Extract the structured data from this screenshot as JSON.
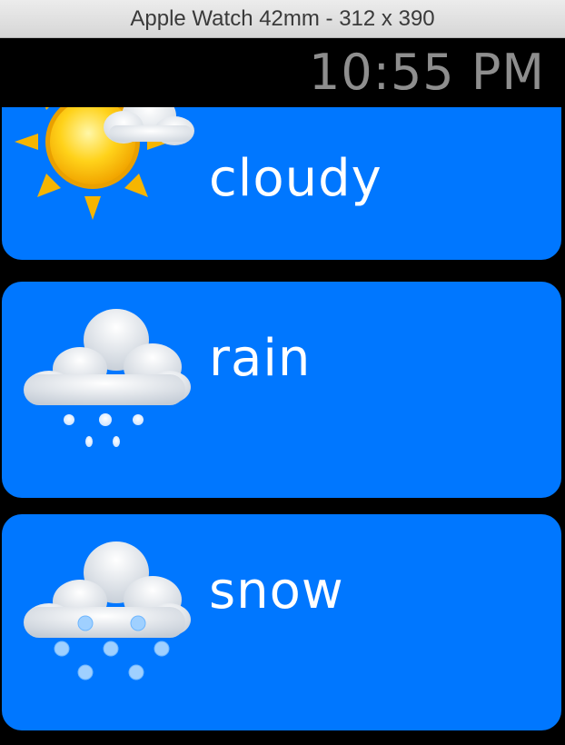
{
  "window": {
    "title": "Apple Watch 42mm - 312 x 390"
  },
  "status": {
    "time": "10:55 PM"
  },
  "rows": [
    {
      "label": "cloudy",
      "icon": "partly-cloudy-sun-icon"
    },
    {
      "label": "rain",
      "icon": "rain-cloud-icon"
    },
    {
      "label": "snow",
      "icon": "snow-cloud-icon"
    }
  ],
  "colors": {
    "card": "#0077ff",
    "time": "#8e8e8e",
    "background": "#000000"
  }
}
